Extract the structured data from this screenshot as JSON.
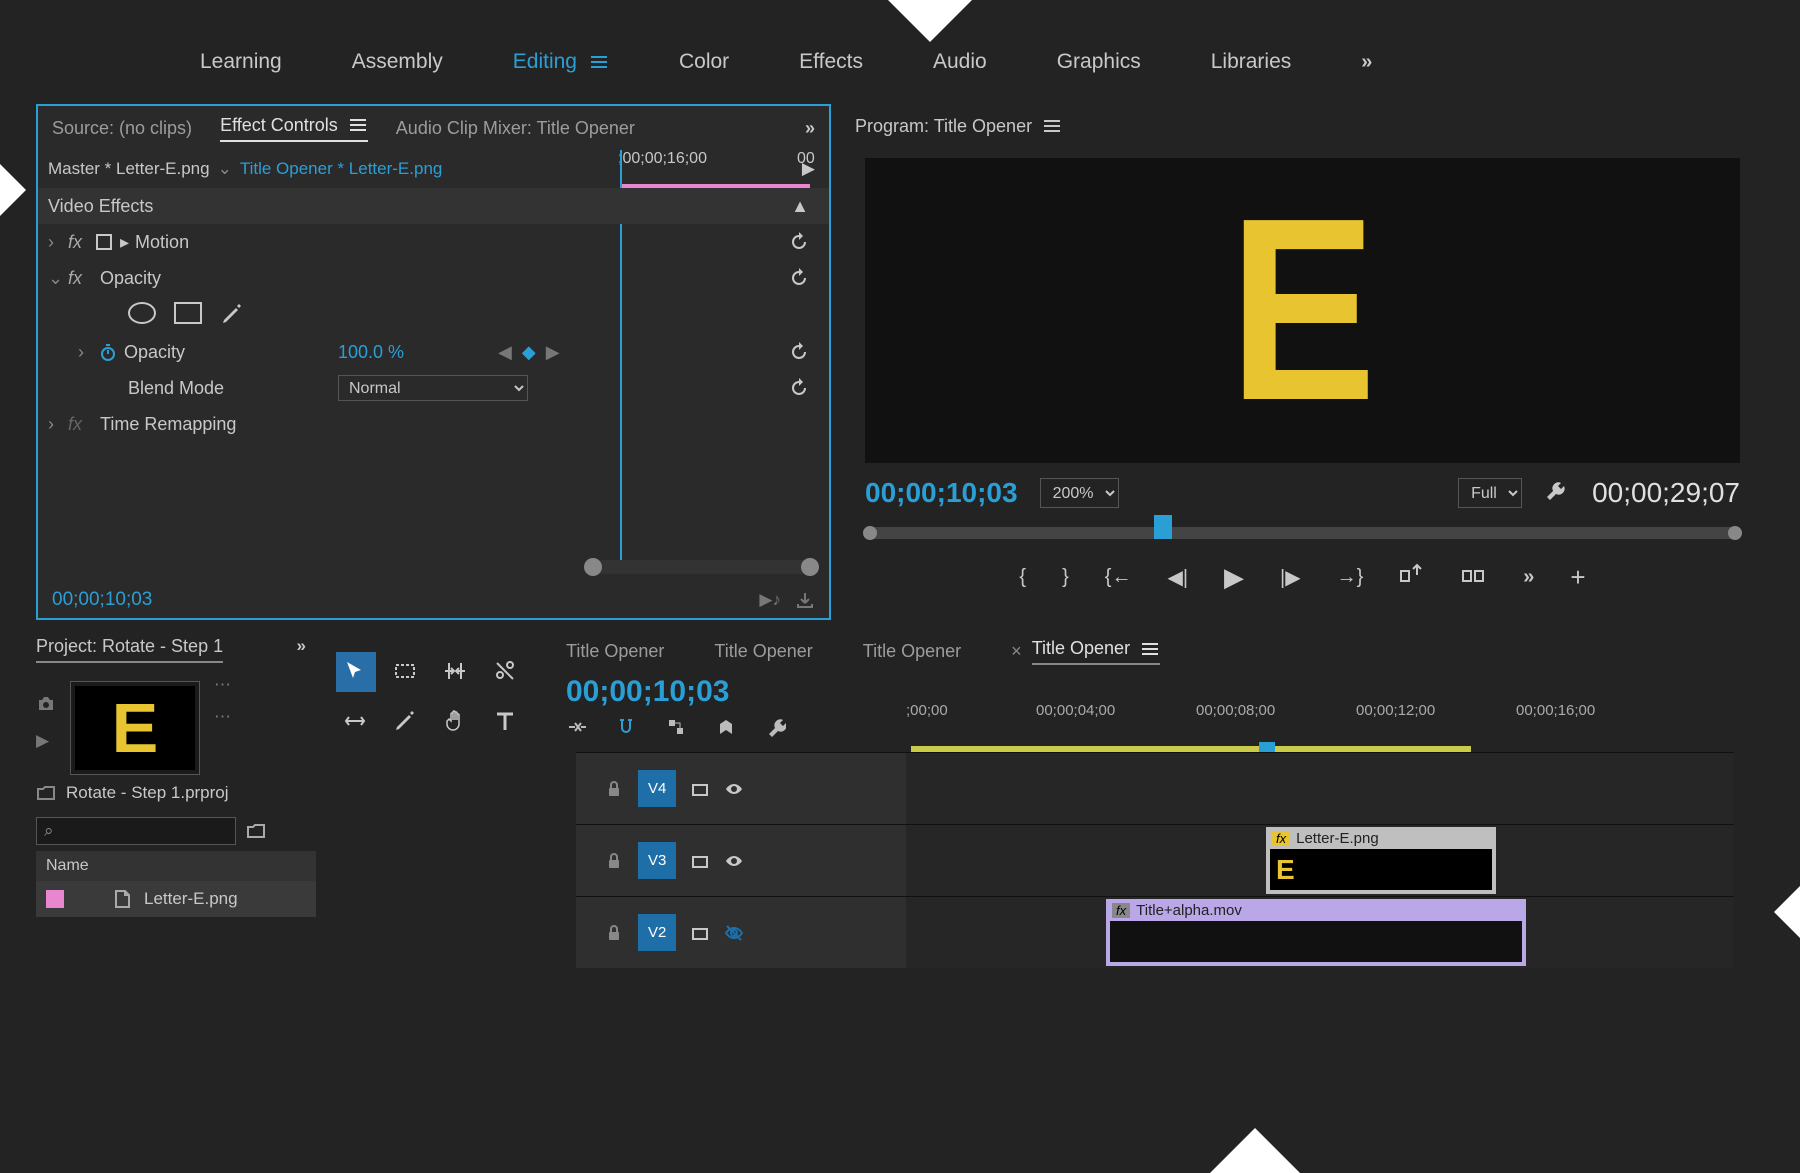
{
  "workspace": {
    "tabs": [
      "Learning",
      "Assembly",
      "Editing",
      "Color",
      "Effects",
      "Audio",
      "Graphics",
      "Libraries"
    ],
    "active": "Editing"
  },
  "sourcePanel": {
    "tabs": {
      "source": "Source: (no clips)",
      "effectControls": "Effect Controls",
      "audioMixer": "Audio Clip Mixer: Title Opener"
    },
    "master": "Master * Letter-E.png",
    "clipContext": "Title Opener * Letter-E.png",
    "timelineHead": {
      "a": ";00;00;16;00",
      "b": "00"
    },
    "clipBar": "Letter-E.png",
    "sections": {
      "videoEffects": "Video Effects",
      "motion": "Motion",
      "opacity": "Opacity",
      "opacityProp": "Opacity",
      "opacityValue": "100.0 %",
      "blendMode": "Blend Mode",
      "blendValue": "Normal",
      "timeRemap": "Time Remapping"
    },
    "footerTC": "00;00;10;03"
  },
  "program": {
    "title": "Program: Title Opener",
    "letter": "E",
    "currentTC": "00;00;10;03",
    "zoom": "200%",
    "resolution": "Full",
    "durationTC": "00;00;29;07"
  },
  "project": {
    "title": "Project: Rotate - Step 1",
    "filename": "Rotate - Step 1.prproj",
    "nameHeader": "Name",
    "item": "Letter-E.png"
  },
  "timeline": {
    "tabs": [
      "Title Opener",
      "Title Opener",
      "Title Opener",
      "Title Opener"
    ],
    "tc": "00;00;10;03",
    "ruler": [
      ";00;00",
      "00;00;04;00",
      "00;00;08;00",
      "00;00;12;00",
      "00;00;16;00"
    ],
    "tracks": {
      "v4": "V4",
      "v3": "V3",
      "v2": "V2"
    },
    "clip1": {
      "name": "Letter-E.png",
      "fx": "fx"
    },
    "clip2": {
      "name": "Title+alpha.mov",
      "fx": "fx"
    }
  }
}
